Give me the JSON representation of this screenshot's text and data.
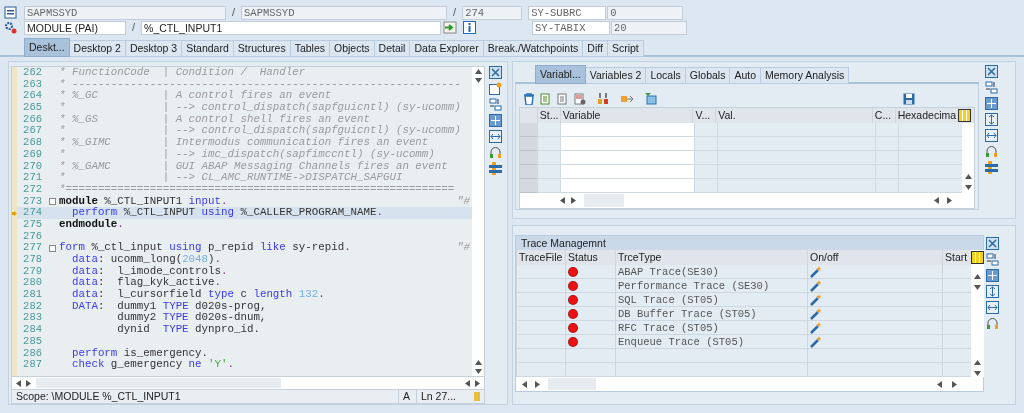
{
  "header": {
    "row1": {
      "program": "SAPMSSYD",
      "include": "SAPMSSYD",
      "line": "274",
      "field_name": "SY-SUBRC",
      "field_value": "0"
    },
    "row2": {
      "event": "MODULE (PAI)",
      "event_name": "%_CTL_INPUT1",
      "field_name": "SY-TABIX",
      "field_value": "20"
    },
    "separator": "/"
  },
  "tabs": [
    {
      "label": "Deskt...",
      "selected": true
    },
    {
      "label": "Desktop 2",
      "selected": false
    },
    {
      "label": "Desktop 3",
      "selected": false
    },
    {
      "label": "Standard",
      "selected": false
    },
    {
      "label": "Structures",
      "selected": false
    },
    {
      "label": "Tables",
      "selected": false
    },
    {
      "label": "Objects",
      "selected": false
    },
    {
      "label": "Detail",
      "selected": false
    },
    {
      "label": "Data Explorer",
      "selected": false
    },
    {
      "label": "Break./Watchpoints",
      "selected": false
    },
    {
      "label": "Diff",
      "selected": false
    },
    {
      "label": "Script",
      "selected": false
    }
  ],
  "editor": {
    "lines": [
      {
        "n": "262",
        "current": false,
        "fold": false,
        "segs": [
          {
            "kind": "comment",
            "text": "* FunctionCode  | Condition /  Handler"
          }
        ]
      },
      {
        "n": "263",
        "current": false,
        "fold": false,
        "segs": [
          {
            "kind": "comment",
            "text": "* ------------------------------------------------------------"
          }
        ]
      },
      {
        "n": "264",
        "current": false,
        "fold": false,
        "segs": [
          {
            "kind": "comment",
            "text": "* %_GC          | A control fires an event"
          }
        ]
      },
      {
        "n": "265",
        "current": false,
        "fold": false,
        "segs": [
          {
            "kind": "comment",
            "text": "*               | --> control_dispatch(sapfguicntl) (sy-ucomm)"
          }
        ]
      },
      {
        "n": "266",
        "current": false,
        "fold": false,
        "segs": [
          {
            "kind": "comment",
            "text": "* %_GS          | A control shell fires an event"
          }
        ]
      },
      {
        "n": "267",
        "current": false,
        "fold": false,
        "segs": [
          {
            "kind": "comment",
            "text": "*               | --> control_dispatch(sapfguicntl) (sy-ucomm)"
          }
        ]
      },
      {
        "n": "268",
        "current": false,
        "fold": false,
        "segs": [
          {
            "kind": "comment",
            "text": "* %_GIMC        | Intermodus communication fires an event"
          }
        ]
      },
      {
        "n": "269",
        "current": false,
        "fold": false,
        "segs": [
          {
            "kind": "comment",
            "text": "*               | --> imc_dispatch(sapfimccntl) (sy-ucomm)"
          }
        ]
      },
      {
        "n": "270",
        "current": false,
        "fold": false,
        "segs": [
          {
            "kind": "comment",
            "text": "* %_GAMC        | GUI ABAP Messaging Channels fires an event"
          }
        ]
      },
      {
        "n": "271",
        "current": false,
        "fold": false,
        "segs": [
          {
            "kind": "comment",
            "text": "*               | --> CL_AMC_RUNTIME->DISPATCH_SAPGUI"
          }
        ]
      },
      {
        "n": "272",
        "current": false,
        "fold": false,
        "segs": [
          {
            "kind": "comment",
            "text": "*============================================================"
          }
        ]
      },
      {
        "n": "273",
        "current": false,
        "fold": true,
        "segs": [
          {
            "kind": "bold",
            "text": "module"
          },
          {
            "kind": "plain",
            "text": " %_CTL_INPUT1 "
          },
          {
            "kind": "keyword",
            "text": "input"
          },
          {
            "kind": "punct",
            "text": "."
          }
        ],
        "trailing": "\"#"
      },
      {
        "n": "274",
        "current": true,
        "fold": false,
        "segs": [
          {
            "kind": "keyword",
            "text": "  perform"
          },
          {
            "kind": "plain",
            "text": " %_CTL_INPUT "
          },
          {
            "kind": "keyword",
            "text": "using"
          },
          {
            "kind": "plain",
            "text": " %_CALLER_PROGRAM_NAME"
          },
          {
            "kind": "punct",
            "text": "."
          }
        ]
      },
      {
        "n": "275",
        "current": false,
        "fold": false,
        "segs": [
          {
            "kind": "bold",
            "text": "endmodule"
          },
          {
            "kind": "punct",
            "text": "."
          }
        ]
      },
      {
        "n": "276",
        "current": false,
        "fold": false
      },
      {
        "n": "277",
        "current": false,
        "fold": true,
        "segs": [
          {
            "kind": "keyword",
            "text": "form"
          },
          {
            "kind": "plain",
            "text": " %_ctl_input "
          },
          {
            "kind": "keyword",
            "text": "using"
          },
          {
            "kind": "plain",
            "text": " p_repid "
          },
          {
            "kind": "keyword",
            "text": "like"
          },
          {
            "kind": "plain",
            "text": " sy-repid"
          },
          {
            "kind": "punct",
            "text": "."
          }
        ],
        "trailing": "\"#"
      },
      {
        "n": "278",
        "current": false,
        "fold": false,
        "segs": [
          {
            "kind": "keyword",
            "text": "  data"
          },
          {
            "kind": "plain",
            "text": ": ucomm_long("
          },
          {
            "kind": "number",
            "text": "2048"
          },
          {
            "kind": "plain",
            "text": ")"
          },
          {
            "kind": "punct",
            "text": "."
          }
        ]
      },
      {
        "n": "279",
        "current": false,
        "fold": false,
        "segs": [
          {
            "kind": "keyword",
            "text": "  data"
          },
          {
            "kind": "plain",
            "text": ":  l_imode_controls"
          },
          {
            "kind": "punct",
            "text": "."
          }
        ]
      },
      {
        "n": "280",
        "current": false,
        "fold": false,
        "segs": [
          {
            "kind": "keyword",
            "text": "  data"
          },
          {
            "kind": "plain",
            "text": ":  flag_kyk_active"
          },
          {
            "kind": "punct",
            "text": "."
          }
        ]
      },
      {
        "n": "281",
        "current": false,
        "fold": false,
        "segs": [
          {
            "kind": "keyword",
            "text": "  data"
          },
          {
            "kind": "plain",
            "text": ":  l_cursorfield "
          },
          {
            "kind": "keyword",
            "text": "type"
          },
          {
            "kind": "plain",
            "text": " c "
          },
          {
            "kind": "keyword",
            "text": "length"
          },
          {
            "kind": "number",
            "text": " 132"
          },
          {
            "kind": "punct",
            "text": "."
          }
        ]
      },
      {
        "n": "282",
        "current": false,
        "fold": false,
        "segs": [
          {
            "kind": "keyword",
            "text": "  DATA"
          },
          {
            "kind": "plain",
            "text": ":  dummy1 "
          },
          {
            "kind": "keyword",
            "text": "TYPE"
          },
          {
            "kind": "plain",
            "text": " d020s-prog,"
          }
        ]
      },
      {
        "n": "283",
        "current": false,
        "fold": false,
        "segs": [
          {
            "kind": "plain",
            "text": "         dummy2 "
          },
          {
            "kind": "keyword",
            "text": "TYPE"
          },
          {
            "kind": "plain",
            "text": " d020s-dnum,"
          }
        ]
      },
      {
        "n": "284",
        "current": false,
        "fold": false,
        "segs": [
          {
            "kind": "plain",
            "text": "         dynid  "
          },
          {
            "kind": "keyword",
            "text": "TYPE"
          },
          {
            "kind": "plain",
            "text": " dynpro_id."
          }
        ]
      },
      {
        "n": "285",
        "current": false,
        "fold": false
      },
      {
        "n": "286",
        "current": false,
        "fold": false,
        "segs": [
          {
            "kind": "keyword",
            "text": "  perform"
          },
          {
            "kind": "plain",
            "text": " is_emergency."
          }
        ]
      },
      {
        "n": "287",
        "current": false,
        "fold": false,
        "segs": [
          {
            "kind": "keyword",
            "text": "  check"
          },
          {
            "kind": "plain",
            "text": " g_emergency "
          },
          {
            "kind": "keyword",
            "text": "ne"
          },
          {
            "kind": "string",
            "text": " 'Y'"
          },
          {
            "kind": "punct",
            "text": "."
          }
        ]
      }
    ],
    "status_bar": {
      "scope": "Scope: \\MODULE %_CTL_INPUT1",
      "mode": "A",
      "position": "Ln 27..."
    }
  },
  "variables": {
    "tabs": [
      {
        "label": "Variabl...",
        "selected": true
      },
      {
        "label": "Variables 2",
        "selected": false
      },
      {
        "label": "Locals",
        "selected": false
      },
      {
        "label": "Globals",
        "selected": false
      },
      {
        "label": "Auto",
        "selected": false
      },
      {
        "label": "Memory Analysis",
        "selected": false
      }
    ],
    "columns": [
      "St...",
      "Variable",
      "V...",
      "Val.",
      "C...",
      "Hexadecima"
    ]
  },
  "trace": {
    "title": "Trace Managemnt",
    "columns": [
      "TraceFile",
      "Status",
      "TrceType",
      "On/off",
      "Start"
    ],
    "rows": [
      {
        "color": "#ee1111",
        "type": "ABAP Trace(SE30)"
      },
      {
        "color": "#ee1111",
        "type": "Performance Trace (SE30)"
      },
      {
        "color": "#ee1111",
        "type": "SQL Trace (ST05)"
      },
      {
        "color": "#ee1111",
        "type": "DB Buffer Trace (ST05)"
      },
      {
        "color": "#ee1111",
        "type": "RFC Trace (ST05)"
      },
      {
        "color": "#ee1111",
        "type": "Enqueue Trace (ST05)"
      }
    ]
  }
}
